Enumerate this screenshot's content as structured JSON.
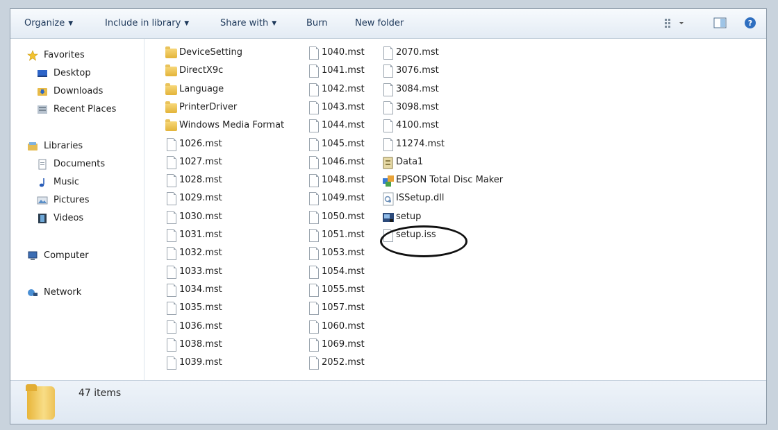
{
  "toolbar": {
    "organize": "Organize",
    "include_in_library": "Include in library",
    "share_with": "Share with",
    "burn": "Burn",
    "new_folder": "New folder"
  },
  "nav": {
    "favorites": "Favorites",
    "desktop": "Desktop",
    "downloads": "Downloads",
    "recent_places": "Recent Places",
    "libraries": "Libraries",
    "documents": "Documents",
    "music": "Music",
    "pictures": "Pictures",
    "videos": "Videos",
    "computer": "Computer",
    "network": "Network"
  },
  "files": {
    "col1": [
      {
        "name": "DeviceSetting",
        "type": "folder"
      },
      {
        "name": "DirectX9c",
        "type": "folder"
      },
      {
        "name": "Language",
        "type": "folder"
      },
      {
        "name": "PrinterDriver",
        "type": "folder"
      },
      {
        "name": "Windows Media Format",
        "type": "folder"
      },
      {
        "name": "1026.mst",
        "type": "file"
      },
      {
        "name": "1027.mst",
        "type": "file"
      },
      {
        "name": "1028.mst",
        "type": "file"
      },
      {
        "name": "1029.mst",
        "type": "file"
      },
      {
        "name": "1030.mst",
        "type": "file"
      },
      {
        "name": "1031.mst",
        "type": "file"
      },
      {
        "name": "1032.mst",
        "type": "file"
      },
      {
        "name": "1033.mst",
        "type": "file"
      },
      {
        "name": "1034.mst",
        "type": "file"
      },
      {
        "name": "1035.mst",
        "type": "file"
      },
      {
        "name": "1036.mst",
        "type": "file"
      },
      {
        "name": "1038.mst",
        "type": "file"
      },
      {
        "name": "1039.mst",
        "type": "file"
      }
    ],
    "col2": [
      {
        "name": "1040.mst",
        "type": "file"
      },
      {
        "name": "1041.mst",
        "type": "file"
      },
      {
        "name": "1042.mst",
        "type": "file"
      },
      {
        "name": "1043.mst",
        "type": "file"
      },
      {
        "name": "1044.mst",
        "type": "file"
      },
      {
        "name": "1045.mst",
        "type": "file"
      },
      {
        "name": "1046.mst",
        "type": "file"
      },
      {
        "name": "1048.mst",
        "type": "file"
      },
      {
        "name": "1049.mst",
        "type": "file"
      },
      {
        "name": "1050.mst",
        "type": "file"
      },
      {
        "name": "1051.mst",
        "type": "file"
      },
      {
        "name": "1053.mst",
        "type": "file"
      },
      {
        "name": "1054.mst",
        "type": "file"
      },
      {
        "name": "1055.mst",
        "type": "file"
      },
      {
        "name": "1057.mst",
        "type": "file"
      },
      {
        "name": "1060.mst",
        "type": "file"
      },
      {
        "name": "1069.mst",
        "type": "file"
      },
      {
        "name": "2052.mst",
        "type": "file"
      }
    ],
    "col3": [
      {
        "name": "2070.mst",
        "type": "file"
      },
      {
        "name": "3076.mst",
        "type": "file"
      },
      {
        "name": "3084.mst",
        "type": "file"
      },
      {
        "name": "3098.mst",
        "type": "file"
      },
      {
        "name": "4100.mst",
        "type": "file"
      },
      {
        "name": "11274.mst",
        "type": "file"
      },
      {
        "name": "Data1",
        "type": "cab"
      },
      {
        "name": "EPSON Total Disc Maker",
        "type": "msi"
      },
      {
        "name": "ISSetup.dll",
        "type": "dll"
      },
      {
        "name": "setup",
        "type": "exe"
      },
      {
        "name": "setup.iss",
        "type": "file"
      }
    ]
  },
  "status": {
    "item_count": "47 items"
  }
}
